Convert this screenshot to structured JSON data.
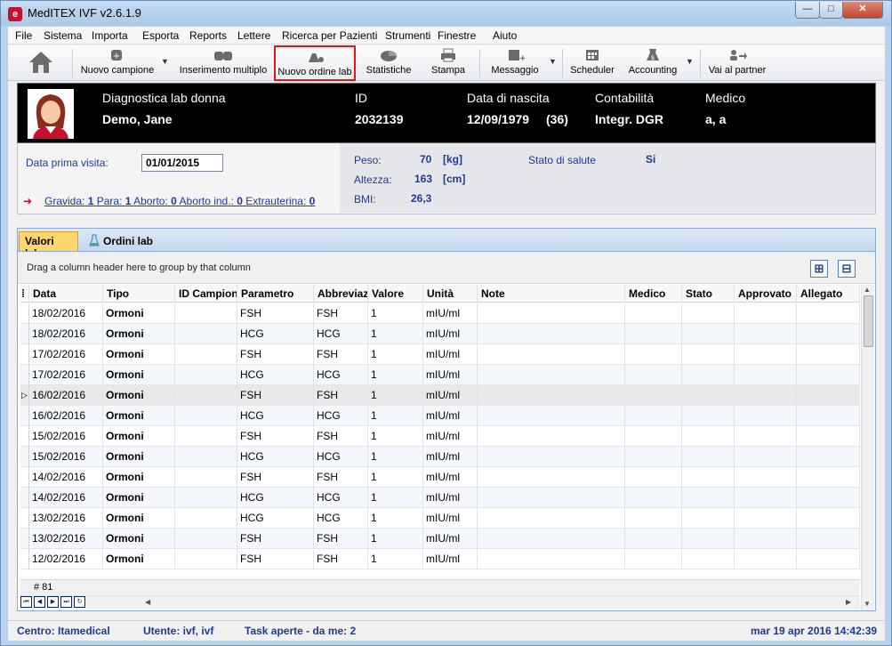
{
  "window": {
    "title": "MedITEX IVF v2.6.1.9",
    "controls": {
      "minimize": "—",
      "maximize": "□",
      "close": "✕"
    }
  },
  "menu": [
    "File",
    "Sistema",
    "Importa",
    "Esporta",
    "Reports",
    "Lettere",
    "Ricerca per Pazienti",
    "Strumenti",
    "Finestre",
    "Aiuto"
  ],
  "toolbar": {
    "home_icon": "home-icon",
    "nuovo_campione": "Nuovo campione",
    "inserimento_multiplo": "Inserimento multiplo",
    "nuovo_ordine_lab": "Nuovo ordine lab",
    "statistiche": "Statistiche",
    "stampa": "Stampa",
    "messaggio": "Messaggio",
    "scheduler": "Scheduler",
    "accounting": "Accounting",
    "vai_al_partner": "Vai al partner",
    "highlight_color": "#e3161b"
  },
  "patient": {
    "group": "Diagnostica lab donna",
    "name": "Demo, Jane",
    "id_label": "ID",
    "id": "2032139",
    "dob_label": "Data di nascita",
    "dob": "12/09/1979",
    "age": "(36)",
    "contab_label": "Contabilità",
    "contab": "Integr. DGR",
    "medico_label": "Medico",
    "medico": "a, a"
  },
  "info": {
    "dpv_label": "Data prima visita:",
    "dpv_value": "01/01/2015",
    "peso_label": "Peso:",
    "peso_value": "70",
    "peso_unit": "[kg]",
    "altezza_label": "Altezza:",
    "altezza_value": "163",
    "altezza_unit": "[cm]",
    "bmi_label": "BMI:",
    "bmi_value": "26,3",
    "stato_label": "Stato di salute",
    "stato_value": "Si",
    "obst": {
      "gravida_label": "Gravida:",
      "gravida": "1",
      "para_label": "Para:",
      "para": "1",
      "aborto_label": "Aborto:",
      "aborto": "0",
      "aborto_ind_label": "Aborto ind.:",
      "aborto_ind": "0",
      "extra_label": "Extrauterina:",
      "extra": "0"
    }
  },
  "tabs": {
    "valori": "Valori lab",
    "ordini": "Ordini lab"
  },
  "grid": {
    "group_hint": "Drag a column header here to group by that column",
    "expand": "⊞",
    "collapse": "⊟",
    "columns": [
      "Data",
      "Tipo",
      "ID Campion",
      "Parametro",
      "Abbreviaz",
      "Valore",
      "Unità",
      "Note",
      "Medico",
      "Stato",
      "Approvato",
      "Allegato"
    ],
    "rows": [
      [
        "18/02/2016",
        "Ormoni",
        "",
        "FSH",
        "FSH",
        "1",
        "mIU/ml"
      ],
      [
        "18/02/2016",
        "Ormoni",
        "",
        "HCG",
        "HCG",
        "1",
        "mIU/ml"
      ],
      [
        "17/02/2016",
        "Ormoni",
        "",
        "FSH",
        "FSH",
        "1",
        "mIU/ml"
      ],
      [
        "17/02/2016",
        "Ormoni",
        "",
        "HCG",
        "HCG",
        "1",
        "mIU/ml"
      ],
      [
        "16/02/2016",
        "Ormoni",
        "",
        "FSH",
        "FSH",
        "1",
        "mIU/ml"
      ],
      [
        "16/02/2016",
        "Ormoni",
        "",
        "HCG",
        "HCG",
        "1",
        "mIU/ml"
      ],
      [
        "15/02/2016",
        "Ormoni",
        "",
        "FSH",
        "FSH",
        "1",
        "mIU/ml"
      ],
      [
        "15/02/2016",
        "Ormoni",
        "",
        "HCG",
        "HCG",
        "1",
        "mIU/ml"
      ],
      [
        "14/02/2016",
        "Ormoni",
        "",
        "FSH",
        "FSH",
        "1",
        "mIU/ml"
      ],
      [
        "14/02/2016",
        "Ormoni",
        "",
        "HCG",
        "HCG",
        "1",
        "mIU/ml"
      ],
      [
        "13/02/2016",
        "Ormoni",
        "",
        "HCG",
        "HCG",
        "1",
        "mIU/ml"
      ],
      [
        "13/02/2016",
        "Ormoni",
        "",
        "FSH",
        "FSH",
        "1",
        "mIU/ml"
      ],
      [
        "12/02/2016",
        "Ormoni",
        "",
        "FSH",
        "FSH",
        "1",
        "mIU/ml"
      ]
    ],
    "selected_index": 4,
    "record_count": "# 81"
  },
  "status": {
    "centro": "Centro: Itamedical",
    "utente": "Utente: ivf, ivf",
    "task": "Task aperte - da me: 2",
    "datetime": "mar 19 apr 2016 14:42:39"
  }
}
